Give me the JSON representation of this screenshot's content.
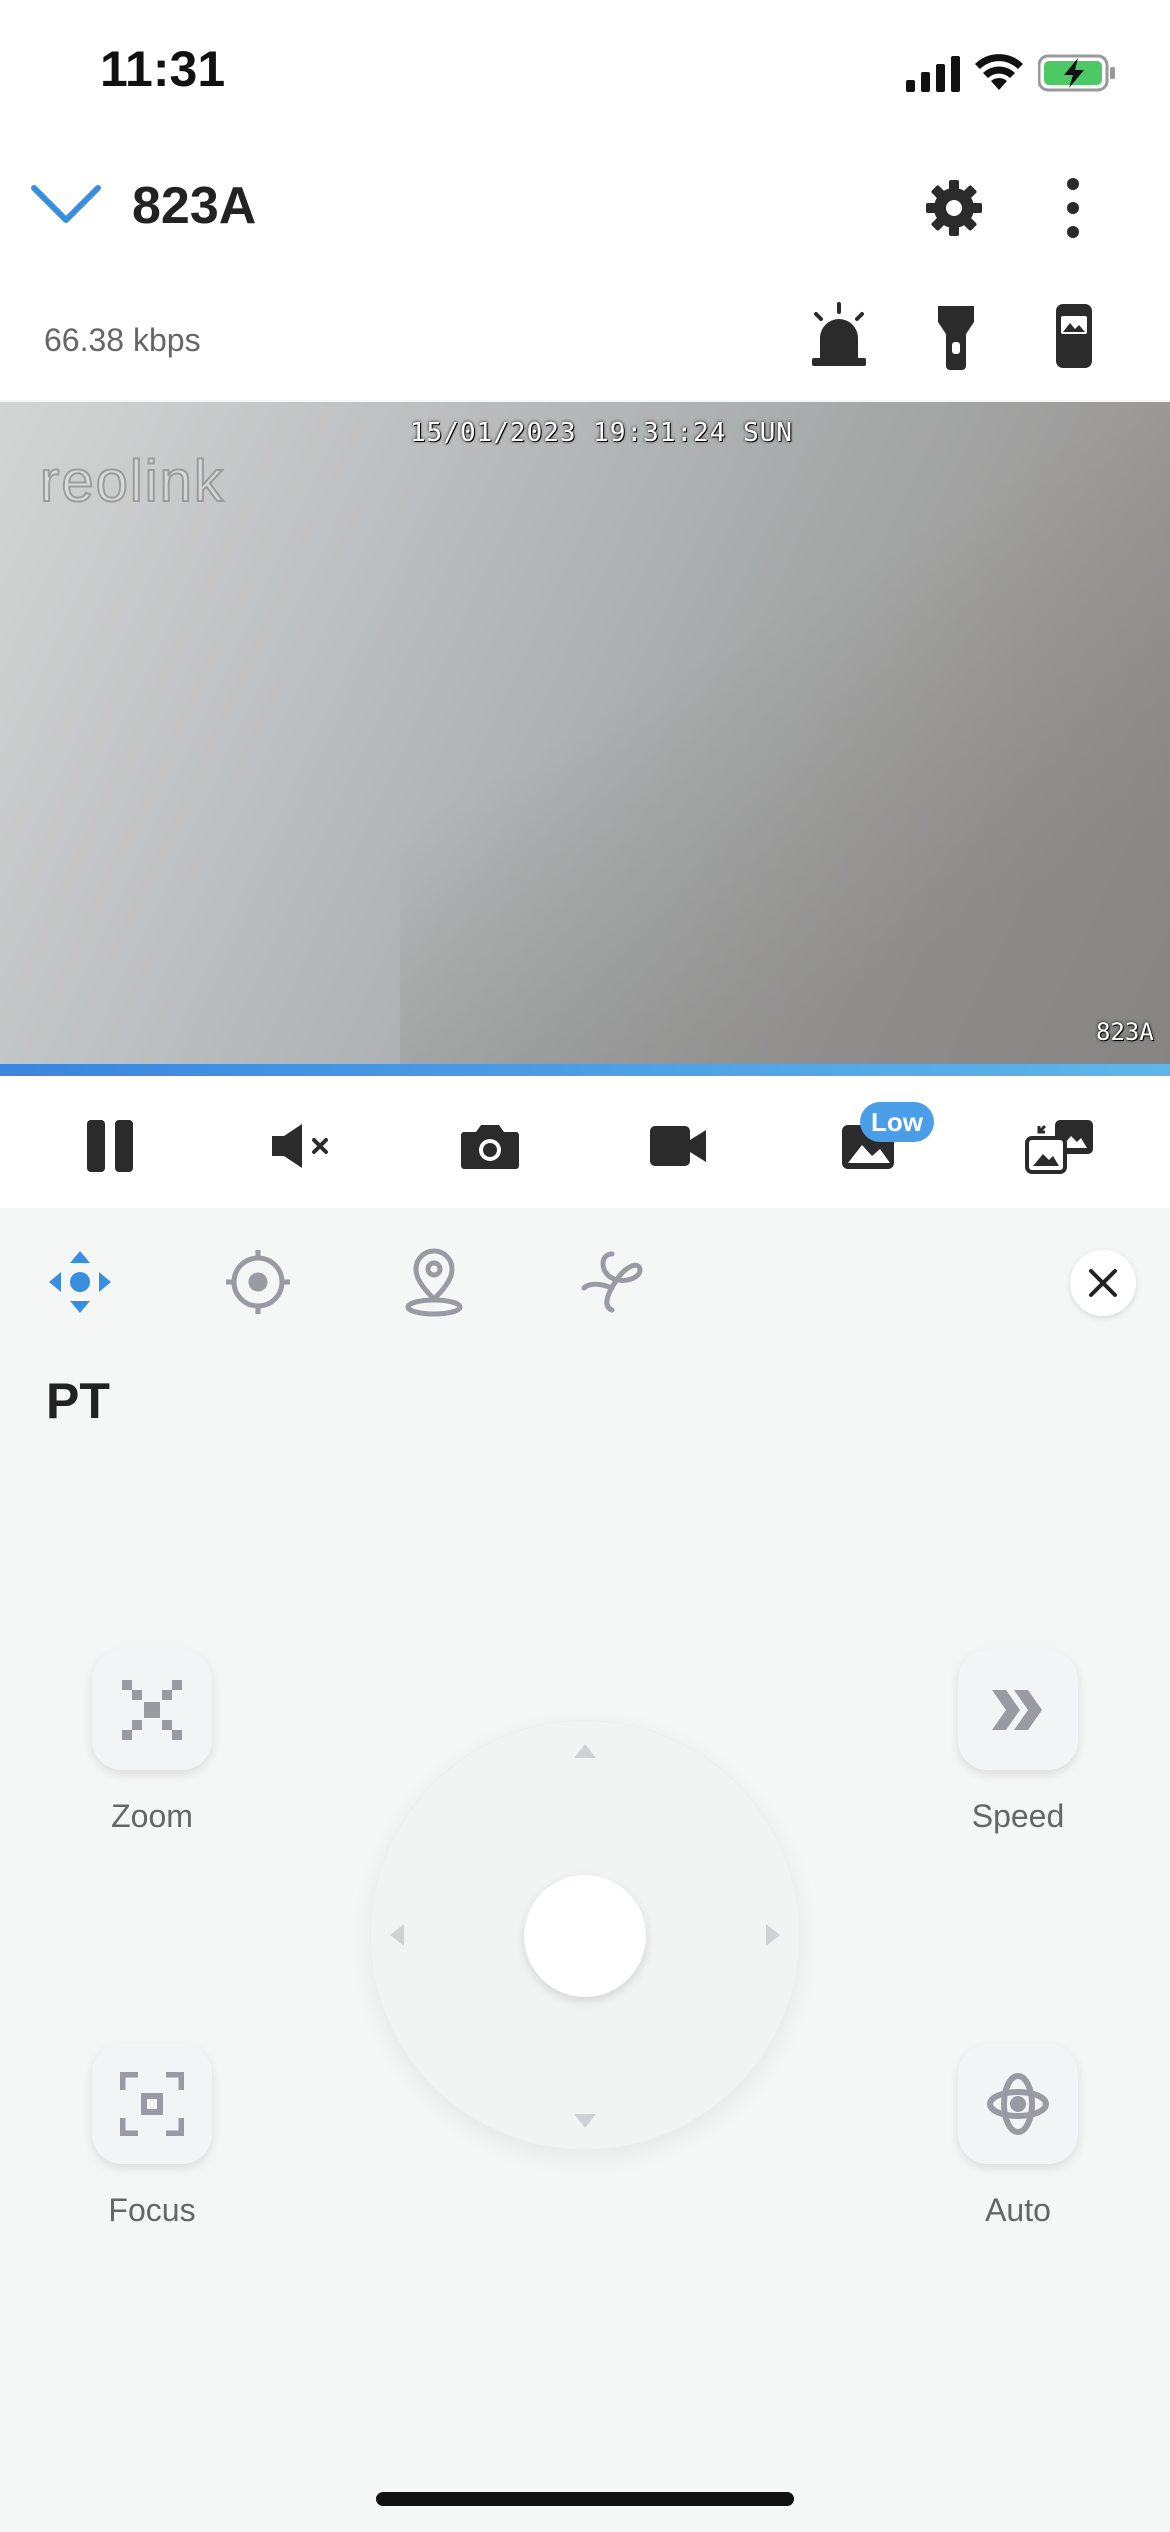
{
  "status_bar": {
    "time": "11:31"
  },
  "header": {
    "title": "823A",
    "bitrate": "66.38 kbps"
  },
  "video": {
    "timestamp": "15/01/2023 19:31:24 SUN",
    "camera_name": "823A",
    "watermark": "reolink"
  },
  "toolbar": {
    "quality_badge": "Low"
  },
  "ptz": {
    "section_title": "PT",
    "zoom_label": "Zoom",
    "speed_label": "Speed",
    "focus_label": "Focus",
    "auto_label": "Auto"
  },
  "colors": {
    "accent": "#3a8ee0",
    "icon_gray": "#9a9aa3",
    "dark_icon": "#2b2b2b"
  }
}
